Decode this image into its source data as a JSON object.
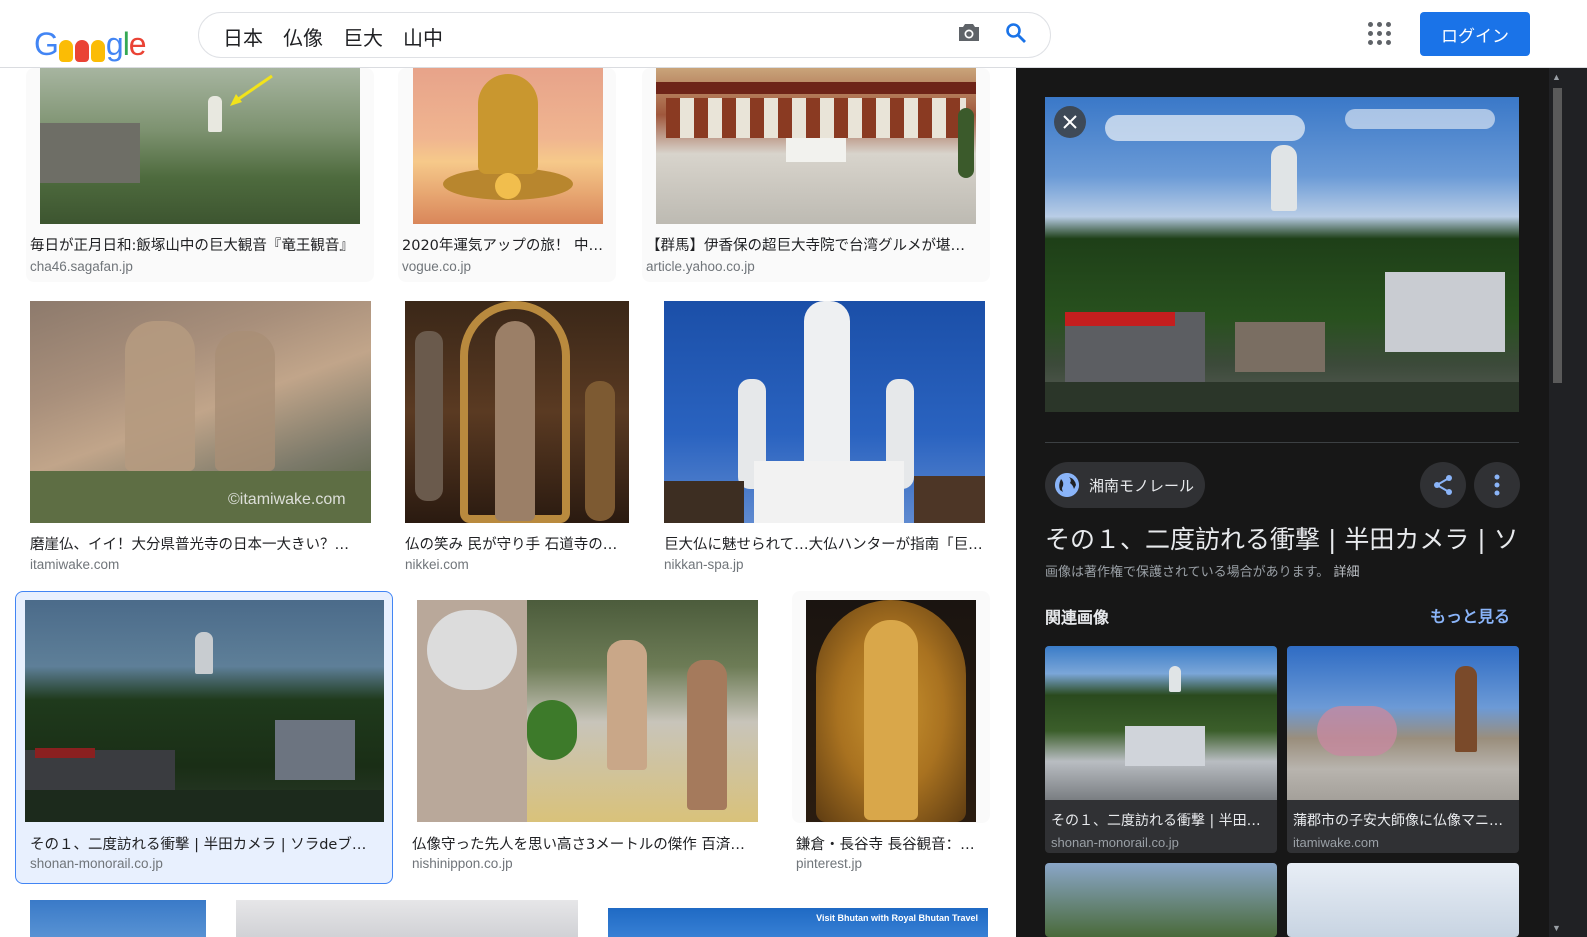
{
  "search": {
    "query": "日本　仏像　巨大　山中"
  },
  "header": {
    "login_label": "ログイン"
  },
  "results": [
    {
      "caption": "毎日が正月日和:飯塚山中の巨大観音『竜王観音』",
      "domain": "cha46.sagafan.jp"
    },
    {
      "caption": "2020年運気アップの旅！ 中…",
      "domain": "vogue.co.jp"
    },
    {
      "caption": "【群馬】伊香保の超巨大寺院で台湾グルメが堪…",
      "domain": "article.yahoo.co.jp"
    },
    {
      "caption": "磨崖仏、イイ！大分県普光寺の日本一大きい？…",
      "domain": "itamiwake.com"
    },
    {
      "caption": "仏の笑み 民が守り手 石道寺の…",
      "domain": "nikkei.com"
    },
    {
      "caption": "巨大仏に魅せられて…大仏ハンターが指南「巨…",
      "domain": "nikkan-spa.jp"
    },
    {
      "caption": "その１、二度訪れる衝撃 | 半田カメラ | ソラdeブ…",
      "domain": "shonan-monorail.co.jp"
    },
    {
      "caption": "仏像守った先人を思い高さ3メートルの傑作 百済…",
      "domain": "nishinippon.co.jp"
    },
    {
      "caption": "鎌倉・長谷寺 長谷観音：…",
      "domain": "pinterest.jp"
    }
  ],
  "thumb_overlays": {
    "watermark": "©itamiwake.com",
    "banner": "Visit Bhutan with Royal Bhutan Travel"
  },
  "panel": {
    "source": "湘南モノレール",
    "title": "その１、二度訪れる衝撃 | 半田カメラ | ソ",
    "copyright": "画像は著作権で保護されている場合があります。",
    "details": "詳細",
    "related_heading": "関連画像",
    "more": "もっと見る",
    "related": [
      {
        "caption": "その１、二度訪れる衝撃 | 半田…",
        "domain": "shonan-monorail.co.jp"
      },
      {
        "caption": "蒲郡市の子安大師像に仏像マニ…",
        "domain": "itamiwake.com"
      }
    ]
  },
  "colors": {
    "accent": "#1a73e8",
    "panel_bg": "#171717",
    "selected_bg": "#e8f0fe",
    "link": "#8ab4f8"
  }
}
